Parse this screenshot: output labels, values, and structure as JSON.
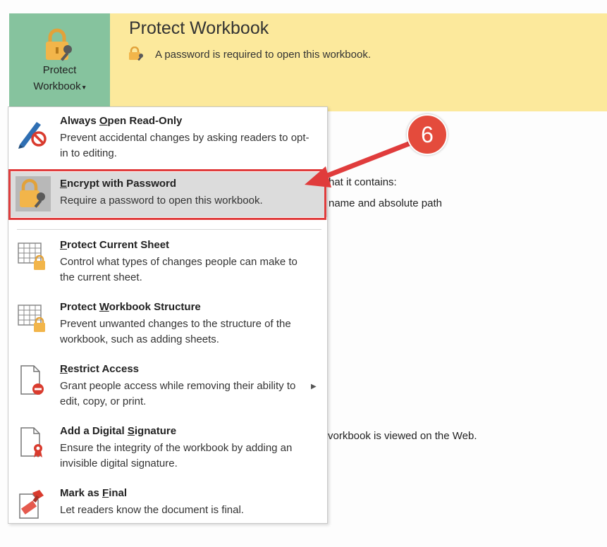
{
  "protect_button": {
    "line1": "Protect",
    "line2": "Workbook",
    "caret": "▾"
  },
  "banner": {
    "title": "Protect Workbook",
    "description": "A password is required to open this workbook."
  },
  "background_texts": [
    "hat it contains:",
    "name and absolute path",
    ".",
    "vorkbook is viewed on the Web."
  ],
  "menu": {
    "items": [
      {
        "icon": "pencil-no-icon",
        "title_pre": "Always ",
        "title_u": "O",
        "title_post": "pen Read-Only",
        "desc": "Prevent accidental changes by asking readers to opt-in to editing."
      },
      {
        "icon": "lock-key-icon",
        "title_pre": "",
        "title_u": "E",
        "title_post": "ncrypt with Password",
        "desc": "Require a password to open this workbook."
      },
      {
        "icon": "sheet-lock-icon",
        "title_pre": "",
        "title_u": "P",
        "title_post": "rotect Current Sheet",
        "desc": "Control what types of changes people can make to the current sheet."
      },
      {
        "icon": "workbook-lock-icon",
        "title_pre": "Protect ",
        "title_u": "W",
        "title_post": "orkbook Structure",
        "desc": "Prevent unwanted changes to the structure of the workbook, such as adding sheets."
      },
      {
        "icon": "document-restrict-icon",
        "title_pre": "",
        "title_u": "R",
        "title_post": "estrict Access",
        "desc": "Grant people access while removing their ability to edit, copy, or print."
      },
      {
        "icon": "document-ribbon-icon",
        "title_pre": "Add a Digital ",
        "title_u": "S",
        "title_post": "ignature",
        "desc": "Ensure the integrity of the workbook by adding an invisible digital signature."
      },
      {
        "icon": "document-stamp-icon",
        "title_pre": "Mark as ",
        "title_u": "F",
        "title_post": "inal",
        "desc": "Let readers know the document is final."
      }
    ],
    "submenu_arrow": "▶"
  },
  "annotation": {
    "number": "6",
    "color": "#e44b3c"
  },
  "colors": {
    "banner": "#fce99c",
    "button": "#86c39e",
    "highlight_border": "#e03c3c",
    "selected_item": "#dcdcdc"
  }
}
